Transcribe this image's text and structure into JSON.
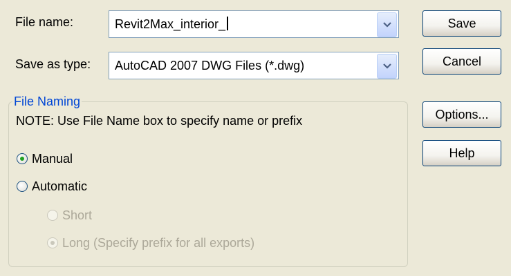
{
  "file_name": {
    "label": "File name:",
    "value": "Revit2Max_interior_"
  },
  "save_as_type": {
    "label": "Save as type:",
    "value": "AutoCAD 2007 DWG Files (*.dwg)"
  },
  "buttons": {
    "save": "Save",
    "cancel": "Cancel",
    "options": "Options...",
    "help": "Help"
  },
  "file_naming": {
    "legend": "File Naming",
    "note": "NOTE: Use File Name box to specify name or prefix",
    "options": [
      {
        "label": "Manual",
        "selected": true,
        "enabled": true
      },
      {
        "label": "Automatic",
        "selected": false,
        "enabled": true
      },
      {
        "label": "Short",
        "selected": false,
        "enabled": false
      },
      {
        "label": "Long (Specify prefix for all exports)",
        "selected": true,
        "enabled": false
      }
    ]
  },
  "icons": {
    "dropdown": "chevron-down-icon"
  }
}
